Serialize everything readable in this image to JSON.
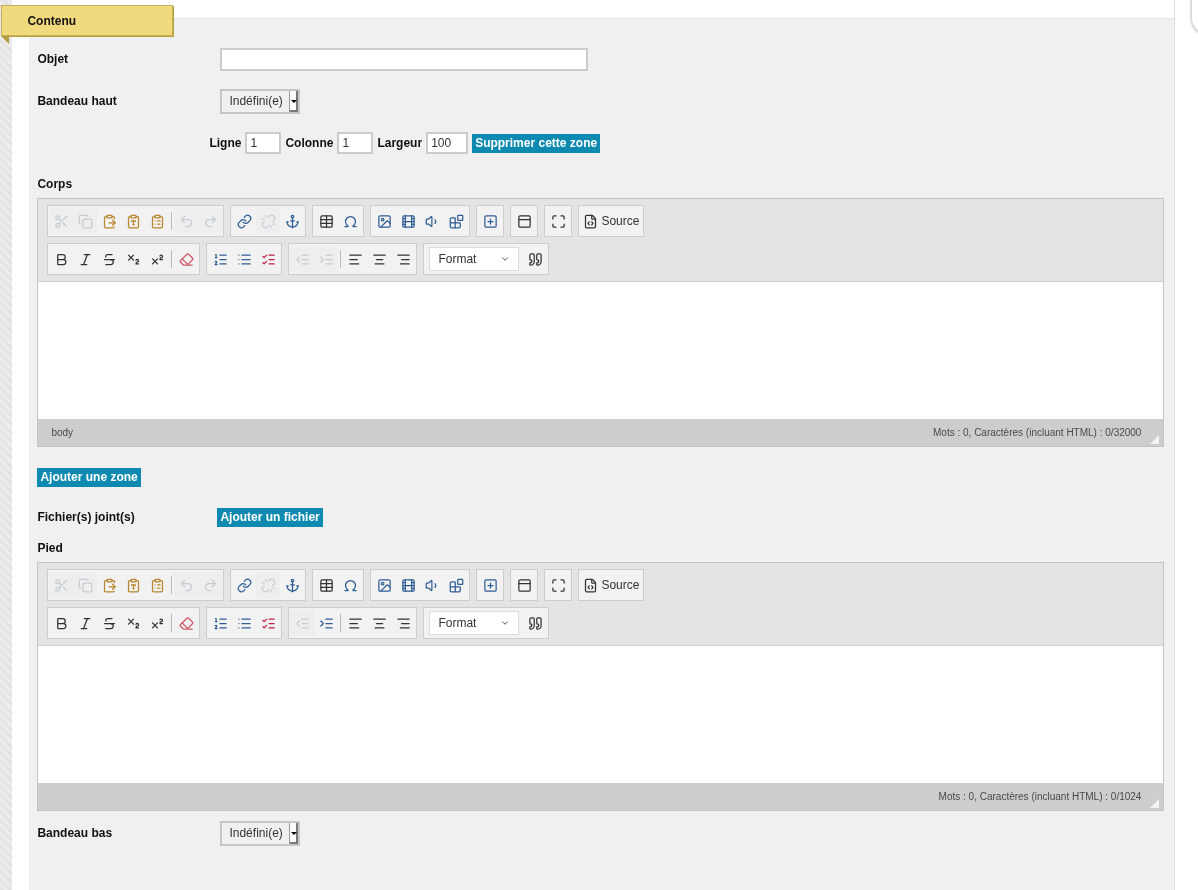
{
  "tab": {
    "label": "Contenu"
  },
  "fields": [
    {
      "kind": "text",
      "label": "Objet"
    },
    {
      "kind": "select",
      "label": "Bandeau haut",
      "value": "Indéfini(e)"
    },
    {
      "kind": "zone",
      "inputs": [
        {
          "label": "Ligne",
          "value": "1"
        },
        {
          "label": "Colonne",
          "value": "1"
        },
        {
          "label": "Largeur",
          "value": "100"
        }
      ],
      "button": "Supprimer cette zone"
    },
    {
      "kind": "editor",
      "label": "Corps",
      "path": "body",
      "counter": "Mots : 0, Caractères (incluant HTML) : 0/32000",
      "toolbar": [
        [
          [
            {
              "kind": "cut",
              "disabled": true
            },
            {
              "kind": "copy",
              "disabled": true
            },
            {
              "kind": "paste",
              "disabled": false
            },
            {
              "kind": "paste-text",
              "disabled": false
            },
            {
              "kind": "paste-word",
              "disabled": false
            },
            {
              "kind": "separator"
            },
            {
              "kind": "undo",
              "disabled": true
            },
            {
              "kind": "redo",
              "disabled": true
            }
          ],
          [
            {
              "kind": "link",
              "disabled": false
            },
            {
              "kind": "unlink",
              "disabled": true
            },
            {
              "kind": "anchor",
              "disabled": false
            }
          ],
          [
            {
              "kind": "table",
              "disabled": false
            },
            {
              "kind": "special-char",
              "disabled": false
            }
          ],
          [
            {
              "kind": "image",
              "disabled": false
            },
            {
              "kind": "video",
              "disabled": false
            },
            {
              "kind": "audio",
              "disabled": false
            },
            {
              "kind": "widget",
              "disabled": false
            }
          ],
          [
            {
              "kind": "placeholder",
              "disabled": false
            }
          ],
          [
            {
              "kind": "iframe",
              "disabled": false
            }
          ],
          [
            {
              "kind": "maximize",
              "disabled": false
            }
          ],
          [
            {
              "kind": "source",
              "label": "Source",
              "disabled": false
            }
          ]
        ],
        [
          [
            {
              "kind": "bold",
              "disabled": false
            },
            {
              "kind": "italic",
              "disabled": false
            },
            {
              "kind": "strike",
              "disabled": false
            },
            {
              "kind": "subscript",
              "disabled": false
            },
            {
              "kind": "superscript",
              "disabled": false
            },
            {
              "kind": "separator"
            },
            {
              "kind": "remove-format",
              "disabled": false
            }
          ],
          [
            {
              "kind": "ordered-list",
              "disabled": false
            },
            {
              "kind": "bullet-list",
              "disabled": false
            },
            {
              "kind": "checklist",
              "disabled": false
            }
          ],
          [
            {
              "kind": "outdent",
              "disabled": true
            },
            {
              "kind": "indent",
              "disabled": true
            },
            {
              "kind": "separator"
            },
            {
              "kind": "align-left",
              "disabled": false
            },
            {
              "kind": "align-center",
              "disabled": false
            },
            {
              "kind": "align-right",
              "disabled": false
            }
          ],
          [
            {
              "kind": "format",
              "label": "Format",
              "disabled": false
            },
            {
              "kind": "blockquote",
              "disabled": false
            }
          ]
        ]
      ]
    },
    {
      "kind": "button",
      "label": "Ajouter une zone"
    },
    {
      "kind": "file",
      "label": "Fichier(s) joint(s)",
      "button": "Ajouter un fichier"
    },
    {
      "kind": "editor",
      "label": "Pied",
      "counter": "Mots : 0, Caractères (incluant HTML) : 0/1024",
      "toolbar": [
        [
          [
            {
              "kind": "cut",
              "disabled": true
            },
            {
              "kind": "copy",
              "disabled": true
            },
            {
              "kind": "paste",
              "disabled": false
            },
            {
              "kind": "paste-text",
              "disabled": false
            },
            {
              "kind": "paste-word",
              "disabled": false
            },
            {
              "kind": "separator"
            },
            {
              "kind": "undo",
              "disabled": true
            },
            {
              "kind": "redo",
              "disabled": true
            }
          ],
          [
            {
              "kind": "link",
              "disabled": false
            },
            {
              "kind": "unlink",
              "disabled": true
            },
            {
              "kind": "anchor",
              "disabled": false
            }
          ],
          [
            {
              "kind": "table",
              "disabled": false
            },
            {
              "kind": "special-char",
              "disabled": false
            }
          ],
          [
            {
              "kind": "image",
              "disabled": false
            },
            {
              "kind": "video",
              "disabled": false
            },
            {
              "kind": "audio",
              "disabled": false
            },
            {
              "kind": "widget",
              "disabled": false
            }
          ],
          [
            {
              "kind": "placeholder",
              "disabled": false
            }
          ],
          [
            {
              "kind": "iframe",
              "disabled": false
            }
          ],
          [
            {
              "kind": "maximize",
              "disabled": false
            }
          ],
          [
            {
              "kind": "source",
              "label": "Source",
              "disabled": false
            }
          ]
        ],
        [
          [
            {
              "kind": "bold",
              "disabled": false
            },
            {
              "kind": "italic",
              "disabled": false
            },
            {
              "kind": "strike",
              "disabled": false
            },
            {
              "kind": "subscript",
              "disabled": false
            },
            {
              "kind": "superscript",
              "disabled": false
            },
            {
              "kind": "separator"
            },
            {
              "kind": "remove-format",
              "disabled": false
            }
          ],
          [
            {
              "kind": "ordered-list",
              "disabled": false
            },
            {
              "kind": "bullet-list",
              "disabled": false
            },
            {
              "kind": "checklist",
              "disabled": false
            }
          ],
          [
            {
              "kind": "outdent",
              "disabled": true
            },
            {
              "kind": "indent",
              "disabled": false
            },
            {
              "kind": "separator"
            },
            {
              "kind": "align-left",
              "disabled": false
            },
            {
              "kind": "align-center",
              "disabled": false
            },
            {
              "kind": "align-right",
              "disabled": false
            }
          ],
          [
            {
              "kind": "format",
              "label": "Format",
              "disabled": false
            },
            {
              "kind": "blockquote",
              "disabled": false
            }
          ]
        ]
      ]
    },
    {
      "kind": "select",
      "label": "Bandeau bas",
      "value": "Indéfini(e)"
    }
  ]
}
